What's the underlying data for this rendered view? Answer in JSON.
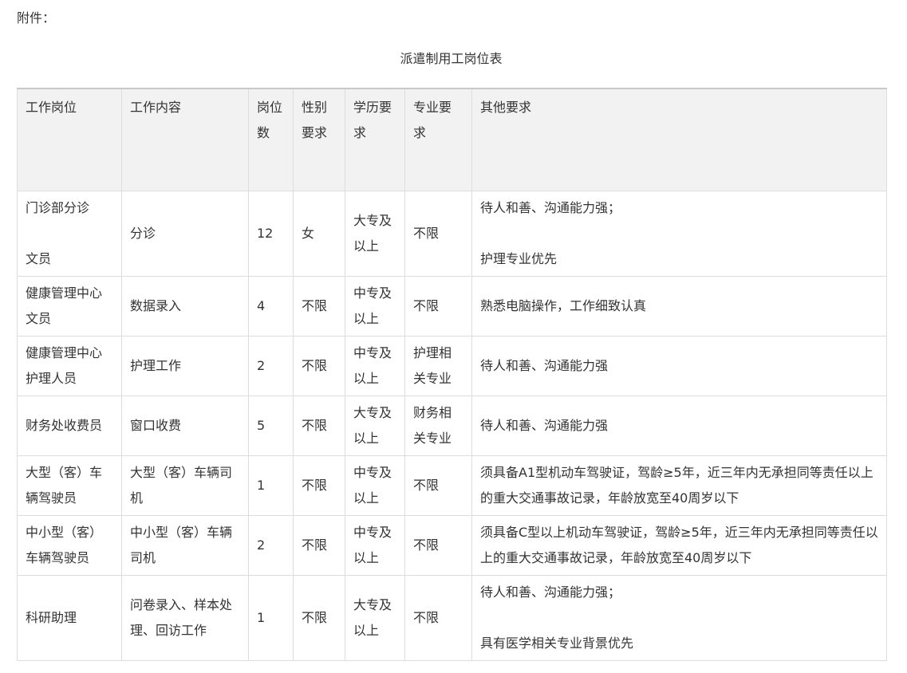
{
  "header": {
    "attachment_label": "附件：",
    "table_title": "派遣制用工岗位表"
  },
  "table": {
    "columns": [
      {
        "key": "position",
        "lines": [
          "工作岗位"
        ]
      },
      {
        "key": "content",
        "lines": [
          "工作内容"
        ]
      },
      {
        "key": "count",
        "lines": [
          "岗位",
          "数"
        ]
      },
      {
        "key": "gender",
        "lines": [
          "性别",
          "要求"
        ]
      },
      {
        "key": "education",
        "lines": [
          "学历要",
          "求"
        ]
      },
      {
        "key": "major",
        "lines": [
          "专业要",
          "求"
        ]
      },
      {
        "key": "other",
        "lines": [
          "其他要求"
        ]
      }
    ],
    "rows": [
      {
        "position": [
          "门诊部分诊",
          "",
          "文员"
        ],
        "content": [
          "分诊"
        ],
        "count": "12",
        "gender": "女",
        "education": [
          "大专及",
          "以上"
        ],
        "major": [
          "不限"
        ],
        "other": [
          "待人和善、沟通能力强；",
          "",
          "护理专业优先"
        ]
      },
      {
        "position": [
          "健康管理中心",
          "文员"
        ],
        "content": [
          "数据录入"
        ],
        "count": "4",
        "gender": "不限",
        "education": [
          "中专及",
          "以上"
        ],
        "major": [
          "不限"
        ],
        "other": [
          "熟悉电脑操作，工作细致认真"
        ]
      },
      {
        "position": [
          "健康管理中心",
          "护理人员"
        ],
        "content": [
          "护理工作"
        ],
        "count": "2",
        "gender": "不限",
        "education": [
          "中专及",
          "以上"
        ],
        "major": [
          "护理相",
          "关专业"
        ],
        "other": [
          "待人和善、沟通能力强"
        ]
      },
      {
        "position": [
          "财务处收费员"
        ],
        "content": [
          "窗口收费"
        ],
        "count": "5",
        "gender": "不限",
        "education": [
          "大专及",
          "以上"
        ],
        "major": [
          "财务相",
          "关专业"
        ],
        "other": [
          "待人和善、沟通能力强"
        ]
      },
      {
        "position": [
          "大型（客）车",
          "辆驾驶员"
        ],
        "content": [
          "大型（客）车辆司",
          "机"
        ],
        "count": "1",
        "gender": "不限",
        "education": [
          "中专及",
          "以上"
        ],
        "major": [
          "不限"
        ],
        "other": [
          "须具备A1型机动车驾驶证，驾龄≥5年，近三年内无承担同等责任以上",
          "的重大交通事故记录，年龄放宽至40周岁以下"
        ]
      },
      {
        "position": [
          "中小型（客）",
          "车辆驾驶员"
        ],
        "content": [
          "中小型（客）车辆",
          "司机"
        ],
        "count": "2",
        "gender": "不限",
        "education": [
          "中专及",
          "以上"
        ],
        "major": [
          "不限"
        ],
        "other": [
          "须具备C型以上机动车驾驶证，驾龄≥5年，近三年内无承担同等责任以",
          "上的重大交通事故记录，年龄放宽至40周岁以下"
        ]
      },
      {
        "position": [
          "科研助理"
        ],
        "content": [
          "问卷录入、样本处",
          "理、回访工作"
        ],
        "count": "1",
        "gender": "不限",
        "education": [
          "大专及",
          "以上"
        ],
        "major": [
          "不限"
        ],
        "other": [
          "待人和善、沟通能力强；",
          "",
          "具有医学相关专业背景优先"
        ]
      }
    ]
  }
}
